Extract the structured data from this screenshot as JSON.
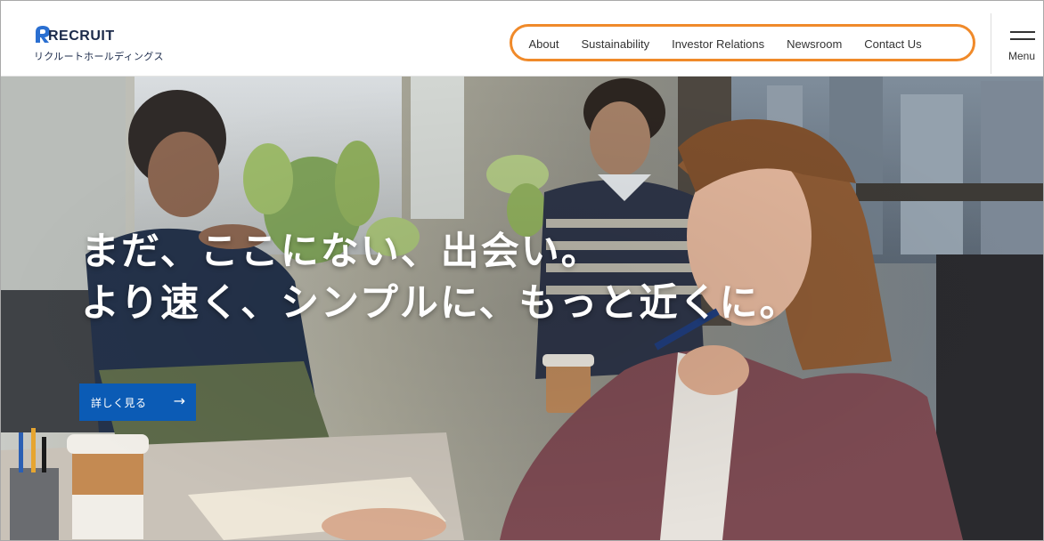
{
  "brand": {
    "name": "RECRUIT",
    "subtitle": "リクルートホールディングス",
    "color": "#1b2a4a",
    "accent": "#2a6fd1"
  },
  "nav": {
    "items": [
      {
        "label": "About"
      },
      {
        "label": "Sustainability"
      },
      {
        "label": "Investor Relations"
      },
      {
        "label": "Newsroom"
      },
      {
        "label": "Contact Us"
      }
    ],
    "highlight_color": "#f08a2a"
  },
  "menu": {
    "label": "Menu",
    "icon": "hamburger-icon"
  },
  "hero": {
    "headline_line1": "まだ、ここにない、出会い。",
    "headline_line2": "より速く、シンプルに、もっと近くに。",
    "cta_label": "詳しく見る",
    "cta_arrow": "→",
    "cta_color": "#0b5bb5"
  }
}
